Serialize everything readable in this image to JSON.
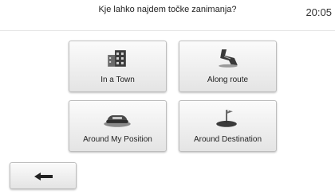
{
  "header": {
    "title": "Kje lahko najdem točke zanimanja?",
    "time": "20:05"
  },
  "options": [
    {
      "label": "In a Town",
      "icon": "city-buildings-icon"
    },
    {
      "label": "Along route",
      "icon": "route-road-icon"
    },
    {
      "label": "Around My Position",
      "icon": "car-position-icon"
    },
    {
      "label": "Around Destination",
      "icon": "destination-flag-icon"
    }
  ],
  "footer": {
    "back_icon": "back-arrow-icon"
  }
}
